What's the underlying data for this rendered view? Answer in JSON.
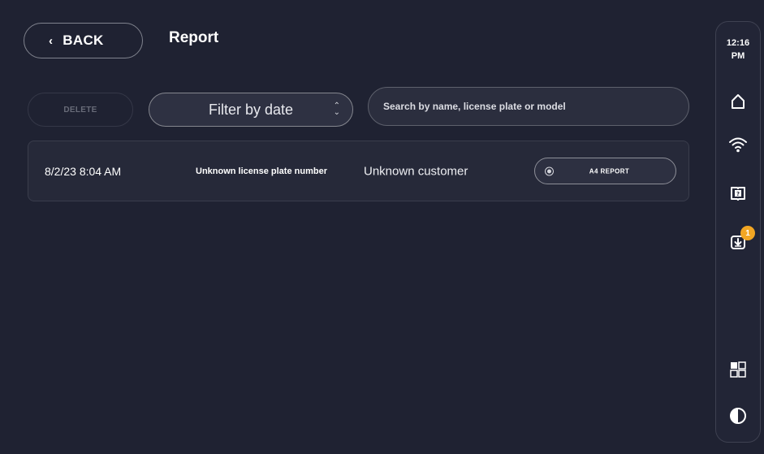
{
  "header": {
    "back_label": "BACK",
    "back_icon": "chevron-left-icon",
    "title": "Report"
  },
  "toolbar": {
    "delete_label": "DELETE",
    "filter_value": "Filter by date",
    "search_placeholder": "Search by name, license plate or model"
  },
  "reports": [
    {
      "datetime": "8/2/23 8:04 AM",
      "license_plate": "Unknown license plate number",
      "customer": "Unknown customer",
      "action_label": "A4 REPORT"
    }
  ],
  "sidebar": {
    "time": "12:16",
    "ampm": "PM",
    "icons": [
      "home-icon",
      "wifi-icon",
      "manual-icon",
      "download-icon",
      "apps-grid-icon",
      "contrast-icon"
    ],
    "download_badge": "1"
  },
  "colors": {
    "background": "#1f2232",
    "badge": "#f2a623"
  }
}
